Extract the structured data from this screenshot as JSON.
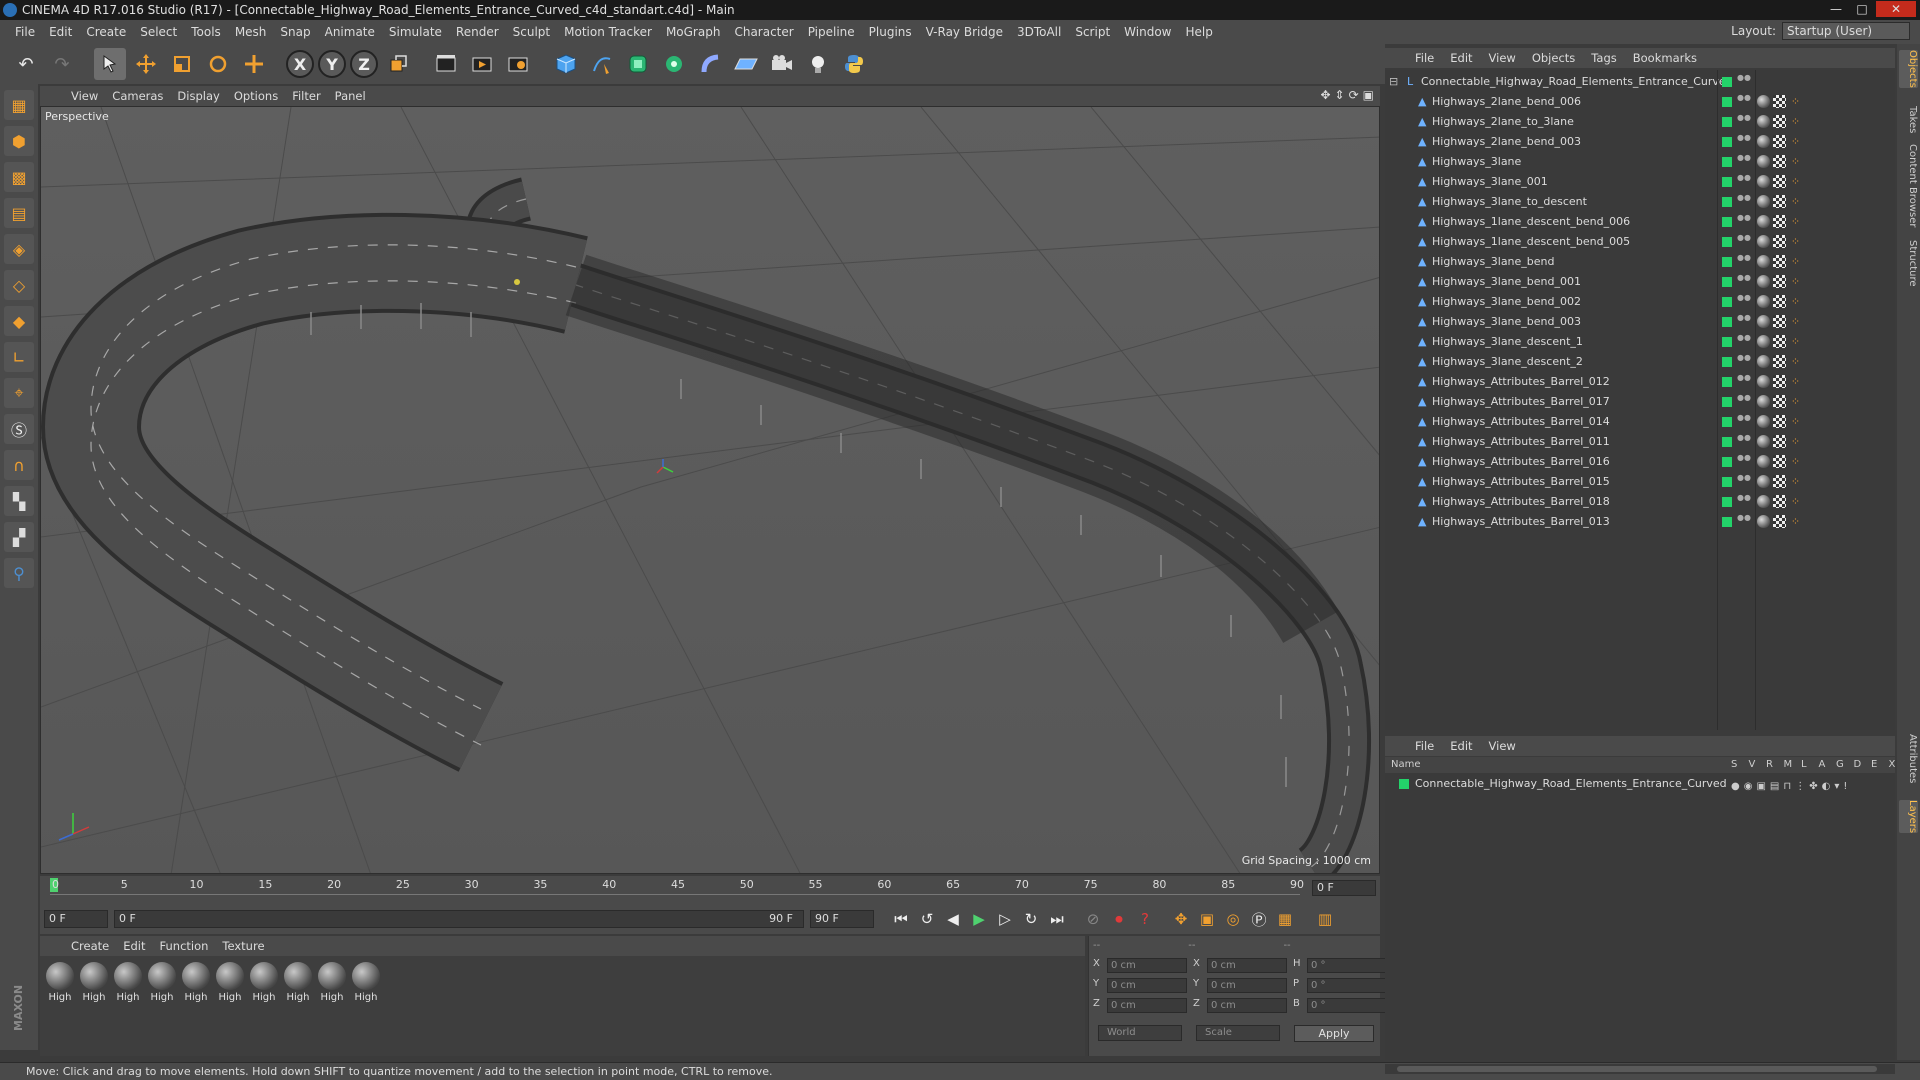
{
  "window": {
    "title": "CINEMA 4D R17.016 Studio (R17) - [Connectable_Highway_Road_Elements_Entrance_Curved_c4d_standart.c4d] - Main",
    "controls": [
      "—",
      "□",
      "✕"
    ]
  },
  "menubar": {
    "items": [
      "File",
      "Edit",
      "Create",
      "Select",
      "Tools",
      "Mesh",
      "Snap",
      "Animate",
      "Simulate",
      "Render",
      "Sculpt",
      "Motion Tracker",
      "MoGraph",
      "Character",
      "Pipeline",
      "Plugins",
      "V-Ray Bridge",
      "3DToAll",
      "Script",
      "Window",
      "Help"
    ],
    "layout_label": "Layout:",
    "layout_value": "Startup (User)"
  },
  "toolbar": {
    "undo": "↶",
    "redo": "↷",
    "axis_x": "X",
    "axis_y": "Y",
    "axis_z": "Z"
  },
  "viewport": {
    "menu": [
      "View",
      "Cameras",
      "Display",
      "Options",
      "Filter",
      "Panel"
    ],
    "label": "Perspective",
    "grid_spacing": "Grid Spacing : 1000 cm",
    "accent_color": "#f0a030"
  },
  "timeline": {
    "ticks": [
      "0",
      "5",
      "10",
      "15",
      "20",
      "25",
      "30",
      "35",
      "40",
      "45",
      "50",
      "55",
      "60",
      "65",
      "70",
      "75",
      "80",
      "85",
      "90"
    ],
    "end_field": "0 F",
    "start_frame": "0 F",
    "range_start": "0 F",
    "range_end": "90 F",
    "max_frame": "90 F"
  },
  "material_manager": {
    "menu": [
      "Create",
      "Edit",
      "Function",
      "Texture"
    ],
    "materials": [
      "High",
      "High",
      "High",
      "High",
      "High",
      "High",
      "High",
      "High",
      "High",
      "High"
    ]
  },
  "coordinates": {
    "header": [
      "--",
      "--",
      "--"
    ],
    "rows": [
      {
        "a": "X",
        "av": "0 cm",
        "b": "X",
        "bv": "0 cm",
        "c": "H",
        "cv": "0 °"
      },
      {
        "a": "Y",
        "av": "0 cm",
        "b": "Y",
        "bv": "0 cm",
        "c": "P",
        "cv": "0 °"
      },
      {
        "a": "Z",
        "av": "0 cm",
        "b": "Z",
        "bv": "0 cm",
        "c": "B",
        "cv": "0 °"
      }
    ],
    "coord_system": "World",
    "mode": "Scale",
    "apply_label": "Apply"
  },
  "status": {
    "text": "Move: Click and drag to move elements. Hold down SHIFT to quantize movement / add to the selection in point mode, CTRL to remove."
  },
  "object_manager": {
    "menu": [
      "File",
      "Edit",
      "View",
      "Objects",
      "Tags",
      "Bookmarks"
    ],
    "root": "Connectable_Highway_Road_Elements_Entrance_Curved",
    "objects": [
      "Highways_2lane_bend_006",
      "Highways_2lane_to_3lane",
      "Highways_2lane_bend_003",
      "Highways_3lane",
      "Highways_3lane_001",
      "Highways_3lane_to_descent",
      "Highways_1lane_descent_bend_006",
      "Highways_1lane_descent_bend_005",
      "Highways_3lane_bend",
      "Highways_3lane_bend_001",
      "Highways_3lane_bend_002",
      "Highways_3lane_bend_003",
      "Highways_3lane_descent_1",
      "Highways_3lane_descent_2",
      "Highways_Attributes_Barrel_012",
      "Highways_Attributes_Barrel_017",
      "Highways_Attributes_Barrel_014",
      "Highways_Attributes_Barrel_011",
      "Highways_Attributes_Barrel_016",
      "Highways_Attributes_Barrel_015",
      "Highways_Attributes_Barrel_018",
      "Highways_Attributes_Barrel_013"
    ],
    "layer_color": "#23d36a"
  },
  "layer_manager": {
    "menu": [
      "File",
      "Edit",
      "View"
    ],
    "columns": [
      "Name",
      "S",
      "V",
      "R",
      "M",
      "L",
      "A",
      "G",
      "D",
      "E",
      "X"
    ],
    "layer": "Connectable_Highway_Road_Elements_Entrance_Curved"
  },
  "right_tabs": [
    "Objects",
    "Takes",
    "Content Browser",
    "Structure",
    "Attributes",
    "Layers"
  ],
  "brand": "MAXON CINEMA 4D"
}
